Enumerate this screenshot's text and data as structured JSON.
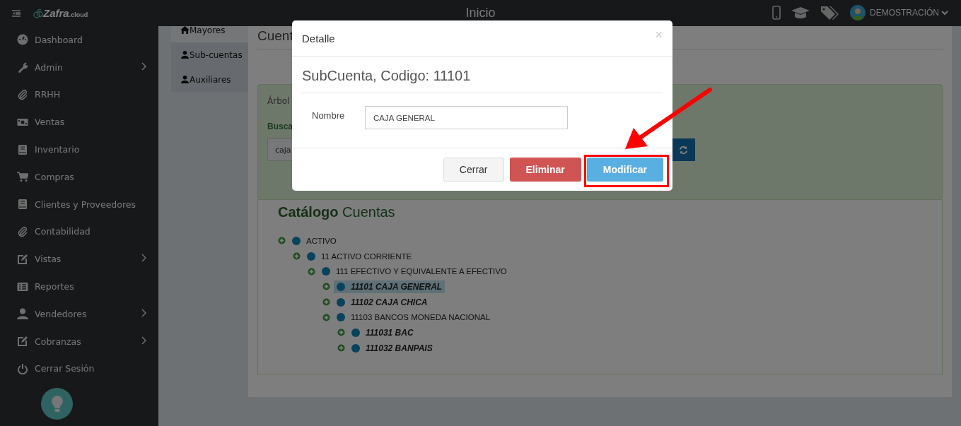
{
  "topbar": {
    "brand": "Zafra",
    "brand_suffix": ".cloud",
    "title": "Inicio",
    "user": "DEMOSTRACIÓN"
  },
  "sidebar": {
    "items": [
      {
        "label": "Dashboard",
        "expandable": false
      },
      {
        "label": "Admin",
        "expandable": true
      },
      {
        "label": "RRHH",
        "expandable": false
      },
      {
        "label": "Ventas",
        "expandable": false
      },
      {
        "label": "Inventario",
        "expandable": false
      },
      {
        "label": "Compras",
        "expandable": false
      },
      {
        "label": "Clientes y Proveedores",
        "expandable": false
      },
      {
        "label": "Contabilidad",
        "expandable": false
      },
      {
        "label": "Vistas",
        "expandable": true
      },
      {
        "label": "Reportes",
        "expandable": false
      },
      {
        "label": "Vendedores",
        "expandable": true
      },
      {
        "label": "Cobranzas",
        "expandable": true
      },
      {
        "label": "Cerrar Sesión",
        "expandable": false
      }
    ]
  },
  "subnav": [
    {
      "label": "Mayores",
      "selected": true
    },
    {
      "label": "Sub-cuentas",
      "selected": false
    },
    {
      "label": "Auxiliares",
      "selected": false
    }
  ],
  "page": {
    "heading": "Cuent",
    "panel_label": "Árbol",
    "search_label": "Busca",
    "search_value": "caja"
  },
  "catalog": {
    "title": "**Catálogo** Cuentas",
    "tree": [
      {
        "label": "ACTIVO",
        "selected": false,
        "children": [
          {
            "label": "11 ACTIVO CORRIENTE",
            "selected": false,
            "children": [
              {
                "label": "111 EFECTIVO Y EQUIVALENTE A EFECTIVO",
                "selected": false,
                "children": [
                  {
                    "label": "11101 CAJA GENERAL",
                    "selected": true
                  },
                  {
                    "label": "11102 CAJA CHICA",
                    "selected": false
                  },
                  {
                    "label": "11103 BANCOS MONEDA NACIONAL",
                    "selected": false,
                    "children": [
                      {
                        "label": "111031 BAC",
                        "selected": false
                      },
                      {
                        "label": "111032 BANPAIS",
                        "selected": false
                      }
                    ]
                  }
                ]
              }
            ]
          }
        ]
      }
    ]
  },
  "modal": {
    "title": "Detalle",
    "close": "×",
    "heading": "SubCuenta, Codigo: 11101",
    "field_label": "Nombre",
    "field_value": "CAJA GENERAL",
    "buttons": [
      {
        "label": "Cerrar",
        "kind": "default"
      },
      {
        "label": "Eliminar",
        "kind": "danger"
      },
      {
        "label": "Modificar",
        "kind": "primary"
      }
    ]
  }
}
